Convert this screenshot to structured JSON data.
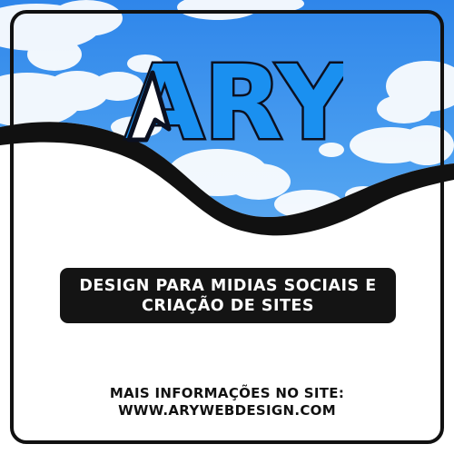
{
  "logo": {
    "text": "ARY",
    "colors": {
      "fill": "#1a90f0",
      "outline": "#0b1020",
      "cursor_fill": "#ffffff"
    },
    "icon": "cursor-arrow-icon"
  },
  "banner": {
    "line1": "DESIGN PARA MIDIAS SOCIAIS E",
    "line2": "CRIAÇÃO DE SITES",
    "background": "#141414",
    "text_color": "#ffffff"
  },
  "footer": {
    "line1": "MAIS INFORMAÇÕES NO SITE:",
    "line2": "WWW.ARYWEBDESIGN.COM"
  },
  "colors": {
    "sky": "#4a9ef0",
    "cloud": "#ffffff",
    "frame": "#111111",
    "panel": "#ffffff"
  }
}
